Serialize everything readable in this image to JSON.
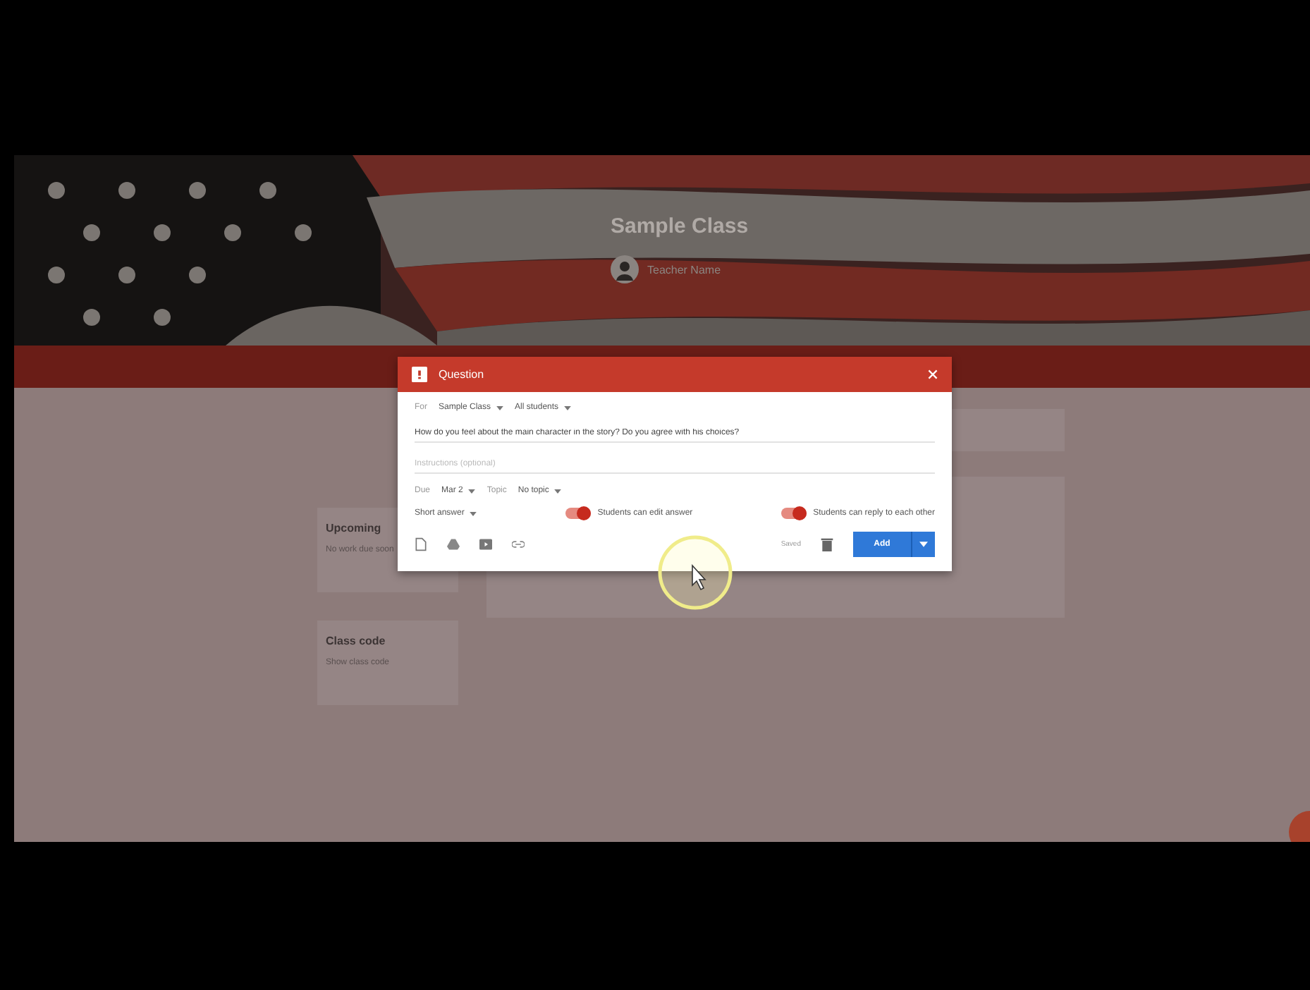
{
  "header": {
    "class_name": "Sample Class",
    "teacher": "Teacher Name"
  },
  "sidebar": [
    {
      "title": "Upcoming",
      "body": "No work due soon"
    },
    {
      "title": "Class code",
      "body": "Show class code"
    }
  ],
  "dialog": {
    "title": "Question",
    "for_label": "For",
    "class": "Sample Class",
    "audience": "All students",
    "question": "How do you feel about the main character in the story? Do you agree with his choices?",
    "instructions_placeholder": "Instructions (optional)",
    "due_label": "Due",
    "due": "Mar 2",
    "topic_label": "Topic",
    "topic": "No topic",
    "answer_type": "Short answer",
    "toggles": [
      {
        "label": "Students can edit answer",
        "on": true
      },
      {
        "label": "Students can reply to each other",
        "on": true
      }
    ],
    "status": "Saved",
    "submit": "Add"
  }
}
